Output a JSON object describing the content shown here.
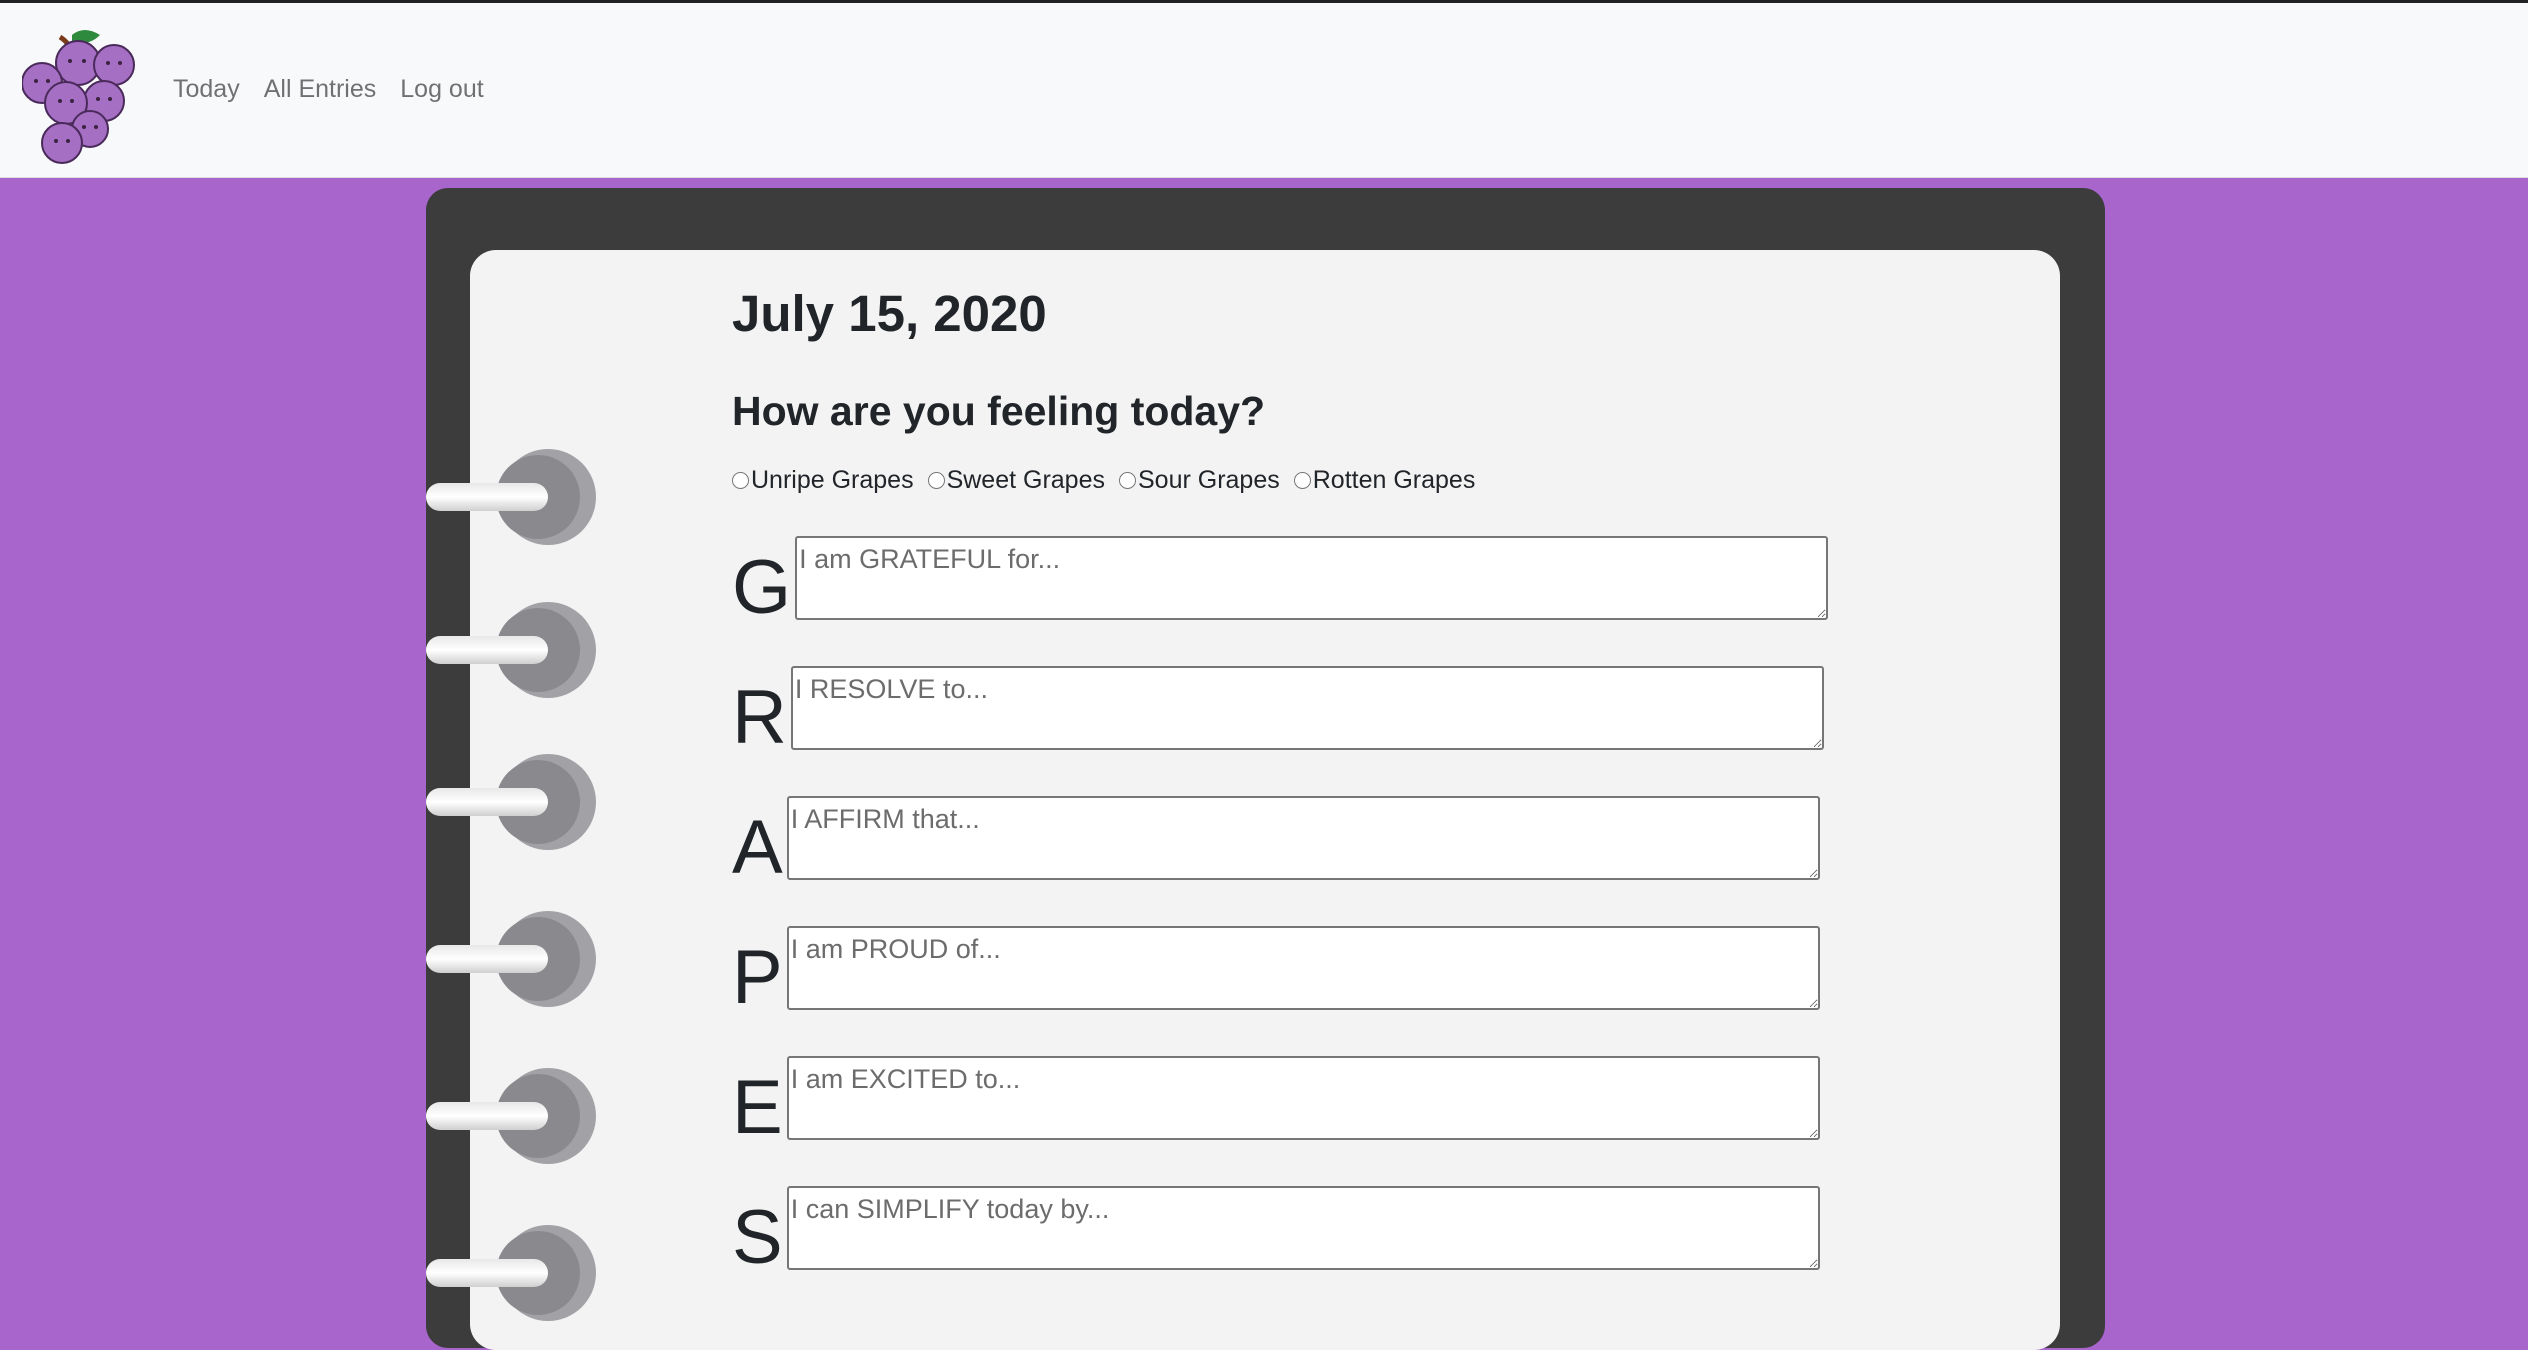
{
  "nav": {
    "links": [
      "Today",
      "All Entries",
      "Log out"
    ]
  },
  "journal": {
    "date": "July 15, 2020",
    "question": "How are you feeling today?",
    "moods": [
      "Unripe Grapes",
      "Sweet Grapes",
      "Sour Grapes",
      "Rotten Grapes"
    ],
    "prompts": [
      {
        "letter": "G",
        "placeholder": "I am GRATEFUL for..."
      },
      {
        "letter": "R",
        "placeholder": "I RESOLVE to..."
      },
      {
        "letter": "A",
        "placeholder": "I AFFIRM that..."
      },
      {
        "letter": "P",
        "placeholder": "I am PROUD of..."
      },
      {
        "letter": "E",
        "placeholder": "I am EXCITED to..."
      },
      {
        "letter": "S",
        "placeholder": "I can SIMPLIFY today by..."
      }
    ]
  },
  "colors": {
    "background": "#a866cc",
    "binder": "#3c3c3c",
    "page": "#f3f3f3",
    "navbar": "#f8f9fa"
  },
  "icons": {
    "logo": "grape-cluster-icon",
    "ring": "binder-ring-icon"
  }
}
